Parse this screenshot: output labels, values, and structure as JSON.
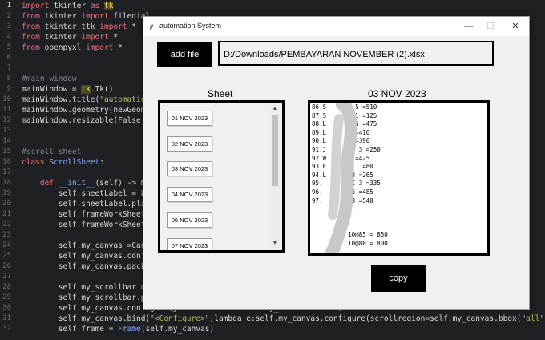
{
  "editor": {
    "lines": [
      {
        "n": "1",
        "html": "<span class='kw'>import</span> tkinter <span class='kw'>as</span> <span class='hl'>tk</span>",
        "active": true
      },
      {
        "n": "2",
        "html": "<span class='kw'>from</span> tkinter <span class='kw'>import</span> filedial"
      },
      {
        "n": "3",
        "html": "<span class='kw'>from</span> tkinter.ttk <span class='kw'>import</span> *"
      },
      {
        "n": "4",
        "html": "<span class='kw'>from</span> tkinter <span class='kw'>import</span> *"
      },
      {
        "n": "5",
        "html": "<span class='kw'>from</span> openpyxl <span class='kw'>import</span> *"
      },
      {
        "n": "6",
        "html": ""
      },
      {
        "n": "7",
        "html": ""
      },
      {
        "n": "8",
        "html": "<span class='cm'>#main window</span>"
      },
      {
        "n": "9",
        "html": "mainWindow = <span class='hl'>tk</span>.Tk()"
      },
      {
        "n": "10",
        "html": "mainWindow.title(<span class='str'>\"automation</span>"
      },
      {
        "n": "11",
        "html": "mainWindow.geometry(newGeome"
      },
      {
        "n": "12",
        "html": "mainWindow.resizable(False,F"
      },
      {
        "n": "13",
        "html": ""
      },
      {
        "n": "14",
        "html": ""
      },
      {
        "n": "15",
        "html": "<span class='cm'>#scroll sheet</span>"
      },
      {
        "n": "16",
        "html": "<span class='kw'>class</span> <span class='fn'>ScrollSheet</span>:"
      },
      {
        "n": "17",
        "html": ""
      },
      {
        "n": "18",
        "html": "    <span class='kw'>def</span> <span class='fn'>__init__</span>(self) -> No"
      },
      {
        "n": "19",
        "html": "        self.sheetLabel = La"
      },
      {
        "n": "20",
        "html": "        self.sheetLabel.plac"
      },
      {
        "n": "21",
        "html": "        self.frameWorkSheet"
      },
      {
        "n": "22",
        "html": "        self.frameWorkSheet."
      },
      {
        "n": "23",
        "html": ""
      },
      {
        "n": "24",
        "html": "        self.my_canvas =Canv"
      },
      {
        "n": "25",
        "html": "        self.my_canvas.confi"
      },
      {
        "n": "26",
        "html": "        self.my_canvas.pack("
      },
      {
        "n": "27",
        "html": ""
      },
      {
        "n": "28",
        "html": "        self.my_scrollbar ="
      },
      {
        "n": "29",
        "html": "        self.my_scrollbar.pa"
      },
      {
        "n": "30",
        "html": "        self.my_canvas.configure(yscrollcommand=self.my_scrollbar.set)"
      },
      {
        "n": "31",
        "html": "        self.my_canvas.bind(<span class='str'>\"&lt;Configure&gt;\"</span>,lambda e:self.my_canvas.configure(scrollregion=self.my_canvas.bbox(<span class='str'>\"all\"</span>)))"
      },
      {
        "n": "32",
        "html": "        self.frame = <span class='fn'>Frame</span>(self.my_canvas)"
      }
    ]
  },
  "window": {
    "title": "automation System",
    "icon": "feather-icon",
    "minimize": "—",
    "maximize": "☐",
    "close": "✕",
    "add_file_label": "add file",
    "file_path": "D:/Downloads/PEMBAYARAN NOVEMBER (2).xlsx",
    "sheet_heading": "Sheet",
    "date_heading": "03 NOV 2023",
    "sheets": [
      "01 NOV 2023",
      "02 NOV 2023",
      "03 NOV 2023",
      "04 NOV 2023",
      "06 NOV 2023",
      "07 NOV 2023"
    ],
    "data_lines": [
      "86.S        5 =510",
      "87.S        1 =125",
      "88.L        6 =475",
      "89.L        =410",
      "90.L      3 =390",
      "91.J       N 3 =250",
      "92.W        =425",
      "93.F        1 =80",
      "94.L       3 =265",
      "95.        I 3 =335",
      "96.        5 =485",
      "97.        3 =540",
      "",
      "",
      "",
      "          10@85 = 850",
      "          10@80 = 800"
    ],
    "copy_label": "copy"
  }
}
